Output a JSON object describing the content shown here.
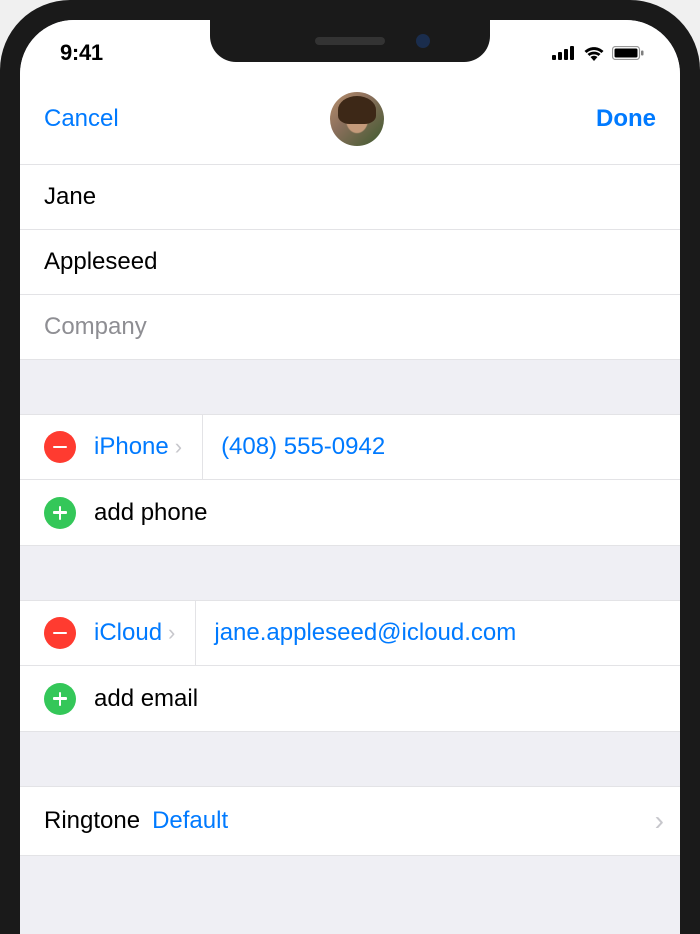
{
  "status": {
    "time": "9:41"
  },
  "nav": {
    "cancel": "Cancel",
    "done": "Done"
  },
  "contact": {
    "first_name": "Jane",
    "last_name": "Appleseed",
    "company_placeholder": "Company"
  },
  "phone": {
    "type_label": "iPhone",
    "value": "(408) 555-0942",
    "add_label": "add phone"
  },
  "email": {
    "type_label": "iCloud",
    "value": "jane.appleseed@icloud.com",
    "add_label": "add email"
  },
  "ringtone": {
    "label": "Ringtone",
    "value": "Default"
  }
}
